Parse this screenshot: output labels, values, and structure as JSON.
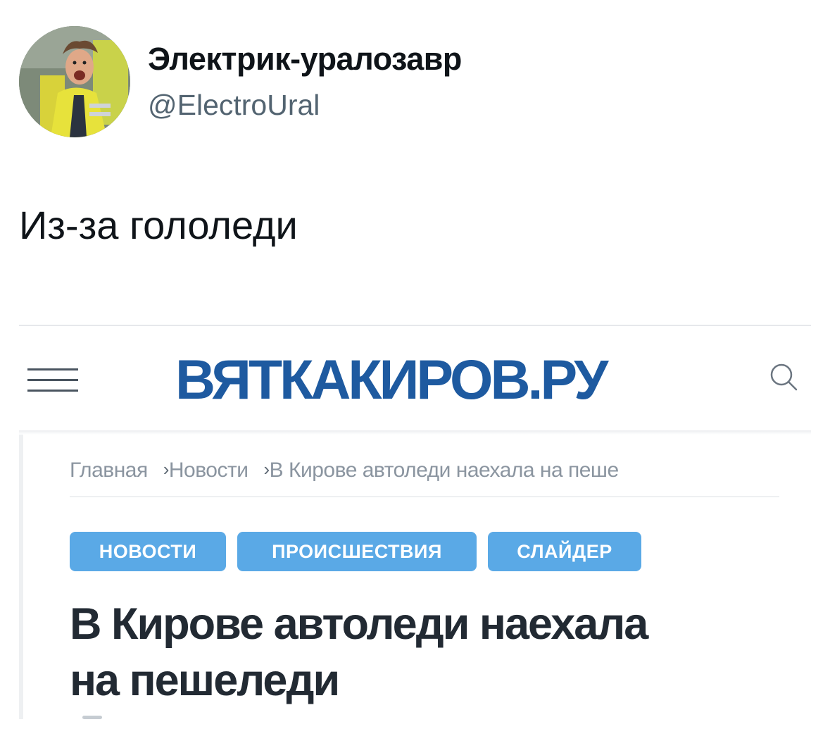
{
  "tweet": {
    "author": {
      "display_name": "Электрик-уралозавр",
      "handle": "@ElectroUral",
      "avatar_icon": "profile-photo"
    },
    "text": "Из-за гололеди"
  },
  "embedded_screenshot": {
    "site": {
      "logo_text": "ВЯТКАКИРОВ.РУ",
      "logo_color": "#1e5aa0",
      "menu_icon": "hamburger-menu-icon",
      "search_icon": "search-icon"
    },
    "breadcrumb": {
      "items": [
        "Главная",
        "Новости",
        "В Кирове автоледи наехала на пеше"
      ]
    },
    "tags": [
      {
        "label": "НОВОСТИ"
      },
      {
        "label": "ПРОИСШЕСТВИЯ"
      },
      {
        "label": "СЛАЙДЕР"
      }
    ],
    "tag_color": "#5aa9e6",
    "article": {
      "title_line1": "В Кирове автоледи наехала",
      "title_line2": "на пешеледи"
    }
  }
}
